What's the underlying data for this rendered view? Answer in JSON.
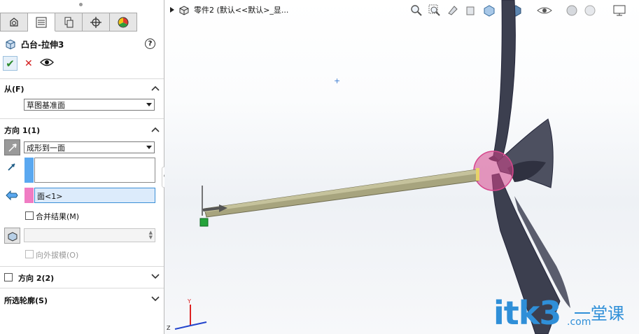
{
  "feature": {
    "title": "凸台-拉伸3",
    "help_icon": "?"
  },
  "from_section": {
    "label": "从(F)",
    "start_condition": "草图基准面"
  },
  "direction1": {
    "label": "方向 1(1)",
    "end_condition": "成形到一面",
    "face_selection": "面<1>",
    "merge_result_label": "合并结果(M)",
    "draft_outward_label": "向外拔模(O)"
  },
  "direction2": {
    "label": "方向 2(2)"
  },
  "selected_contours": {
    "label": "所选轮廓(S)"
  },
  "tree": {
    "part_label": "零件2 (默认<<默认>_显..."
  },
  "triad": {
    "x": "X",
    "y": "Y",
    "z": "Z"
  },
  "watermark": {
    "main": "itk3",
    "secondary": "一堂课",
    "domain": ".com"
  },
  "colors": {
    "accent_blue": "#5aa8f0",
    "pink_chip": "#f07cc3",
    "ok_green": "#2b8a2b",
    "cancel_red": "#d21a1a",
    "model_khaki": "#a7a47e",
    "model_dark": "#3c3f4f"
  }
}
